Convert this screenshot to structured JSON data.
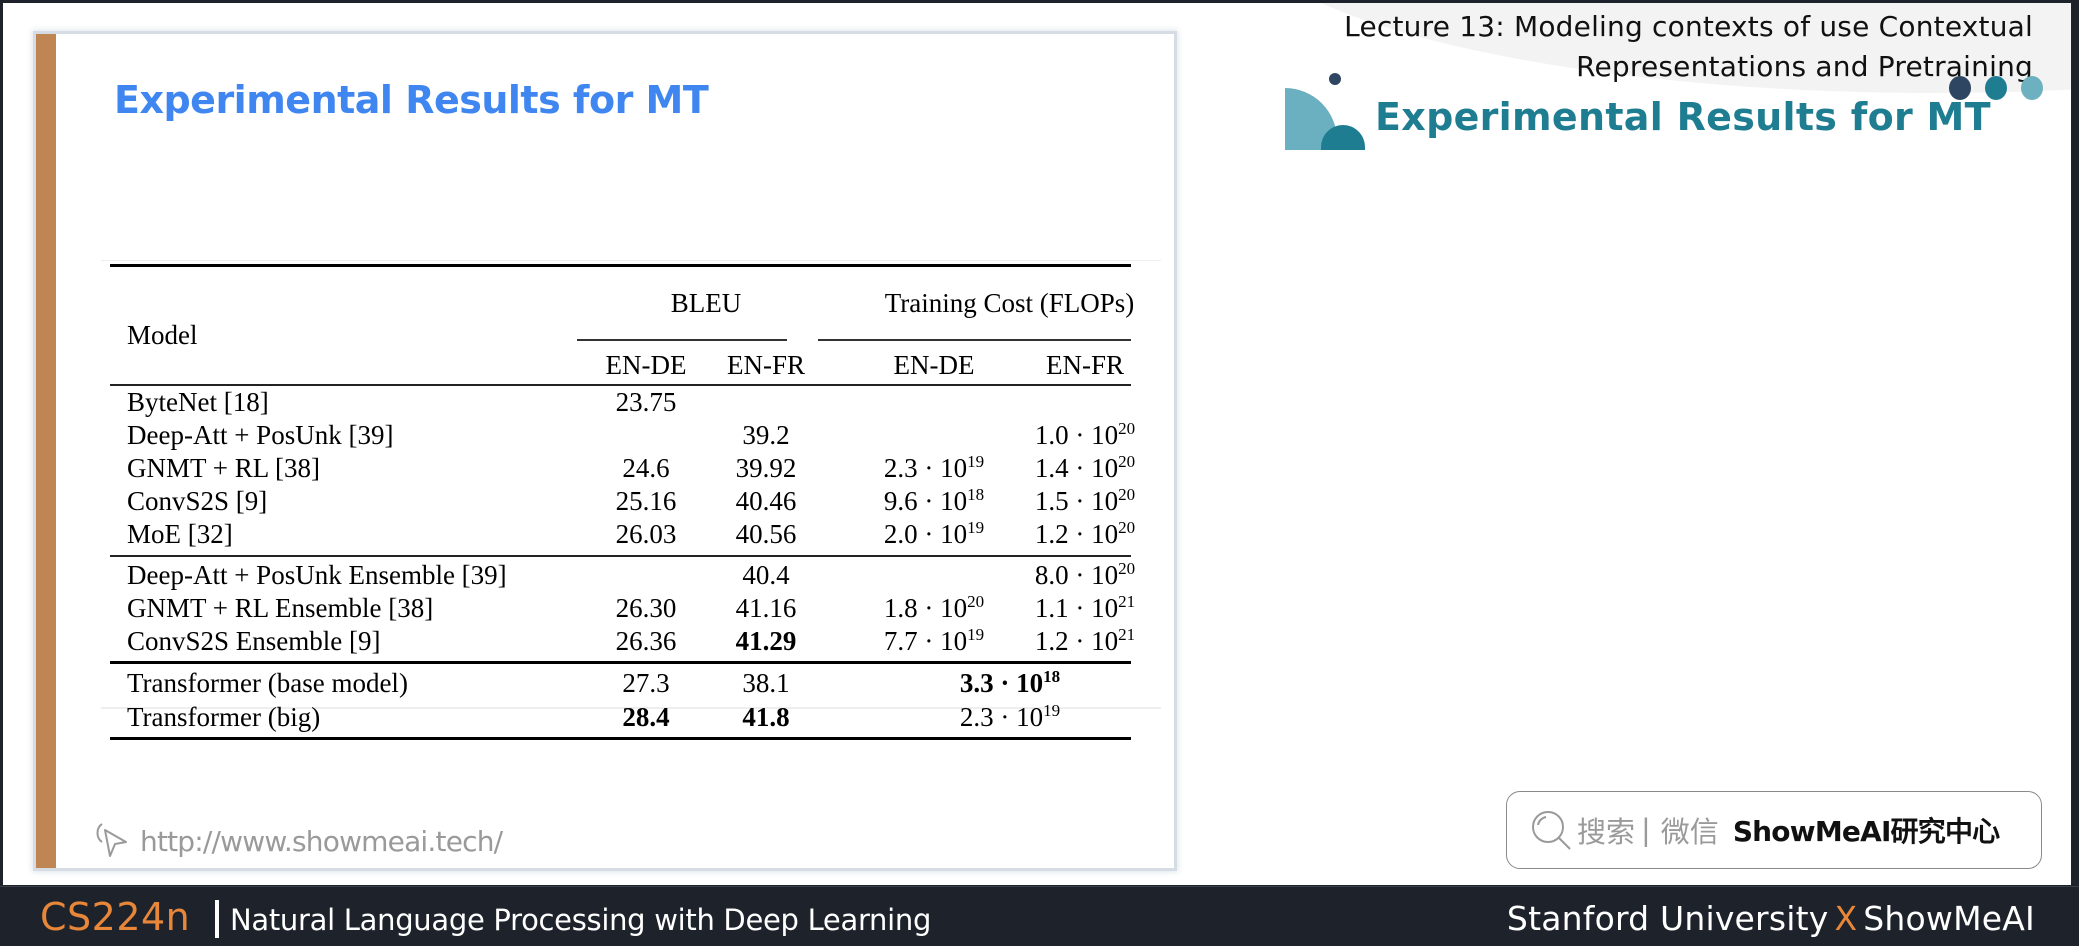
{
  "header": {
    "lecture_title_line1": "Lecture 13:  Modeling contexts of use Contextual",
    "lecture_title_line2": "Representations and Pretraining",
    "section_title": "Experimental Results for MT",
    "accent_colors": {
      "navy": "#2f4662",
      "teal": "#1f7d92",
      "light_teal": "#6db0c0"
    }
  },
  "slide": {
    "title": "Experimental Results for MT",
    "title_color": "#3f86f0",
    "bar_color": "#bf8553",
    "url": "http://www.showmeai.tech/",
    "url_icon": "cursor-click-icon"
  },
  "table": {
    "header_model": "Model",
    "group_bleu": "BLEU",
    "group_cost": "Training Cost (FLOPs)",
    "sub_headers": [
      "EN-DE",
      "EN-FR",
      "EN-DE",
      "EN-FR"
    ],
    "groups": [
      {
        "rows": [
          {
            "model": "ByteNet [18]",
            "bleu_de": "23.75",
            "bleu_fr": "",
            "cost_de": "",
            "cost_fr": ""
          },
          {
            "model": "Deep-Att + PosUnk [39]",
            "bleu_de": "",
            "bleu_fr": "39.2",
            "cost_de": "",
            "cost_fr": "1.0 · 10^20"
          },
          {
            "model": "GNMT + RL [38]",
            "bleu_de": "24.6",
            "bleu_fr": "39.92",
            "cost_de": "2.3 · 10^19",
            "cost_fr": "1.4 · 10^20"
          },
          {
            "model": "ConvS2S [9]",
            "bleu_de": "25.16",
            "bleu_fr": "40.46",
            "cost_de": "9.6 · 10^18",
            "cost_fr": "1.5 · 10^20"
          },
          {
            "model": "MoE [32]",
            "bleu_de": "26.03",
            "bleu_fr": "40.56",
            "cost_de": "2.0 · 10^19",
            "cost_fr": "1.2 · 10^20"
          }
        ]
      },
      {
        "rows": [
          {
            "model": "Deep-Att + PosUnk Ensemble [39]",
            "bleu_de": "",
            "bleu_fr": "40.4",
            "cost_de": "",
            "cost_fr": "8.0 · 10^20"
          },
          {
            "model": "GNMT + RL Ensemble [38]",
            "bleu_de": "26.30",
            "bleu_fr": "41.16",
            "cost_de": "1.8 · 10^20",
            "cost_fr": "1.1 · 10^21"
          },
          {
            "model": "ConvS2S Ensemble [9]",
            "bleu_de": "26.36",
            "bleu_fr": "41.29",
            "bleu_fr_bold": true,
            "cost_de": "7.7 · 10^19",
            "cost_fr": "1.2 · 10^21"
          }
        ]
      },
      {
        "rows": [
          {
            "model": "Transformer (base model)",
            "bleu_de": "27.3",
            "bleu_fr": "38.1",
            "cost_merged": "3.3 · 10^18",
            "cost_bold": true
          },
          {
            "model": "Transformer (big)",
            "bleu_de": "28.4",
            "bleu_de_bold": true,
            "bleu_fr": "41.8",
            "bleu_fr_bold": true,
            "cost_merged": "2.3 · 10^19"
          }
        ]
      }
    ]
  },
  "search": {
    "icon": "search-icon",
    "hint_left": "搜索",
    "separator": "|",
    "hint_right": "微信",
    "brand": "ShowMeAI研究中心"
  },
  "footer": {
    "course_code": "CS224n",
    "course_name": "Natural Language Processing with Deep Learning",
    "right_left": "Stanford University",
    "right_x": "X",
    "right_right": "ShowMeAI",
    "accent": "#e8873a"
  }
}
